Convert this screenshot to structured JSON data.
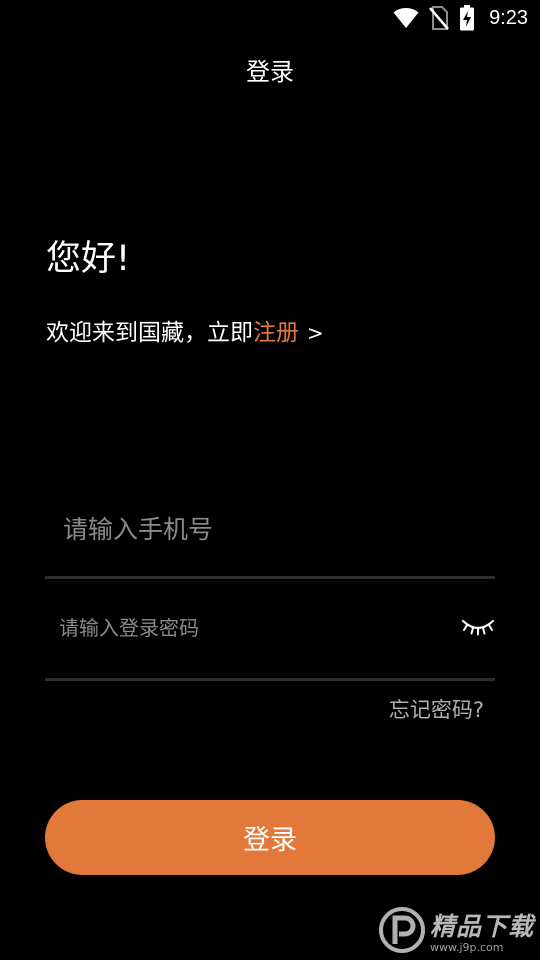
{
  "status_bar": {
    "time": "9:23",
    "icons": [
      "wifi-icon",
      "no-sim-icon",
      "battery-charging-icon"
    ]
  },
  "header": {
    "title": "登录"
  },
  "greeting": {
    "hello": "您好!",
    "welcome_prefix": "欢迎来到国藏，立即",
    "register_link": "注册",
    "register_arrow": ">"
  },
  "form": {
    "phone_placeholder": "请输入手机号",
    "phone_value": "",
    "password_placeholder": "请输入登录密码",
    "password_value": "",
    "password_toggle_icon": "eye-closed-icon",
    "forgot_password": "忘记密码?"
  },
  "actions": {
    "login_label": "登录"
  },
  "colors": {
    "background": "#000000",
    "accent": "#e27839",
    "link": "#e57a3c",
    "divider": "#2d2d2d",
    "placeholder": "#8a8a8a"
  }
}
